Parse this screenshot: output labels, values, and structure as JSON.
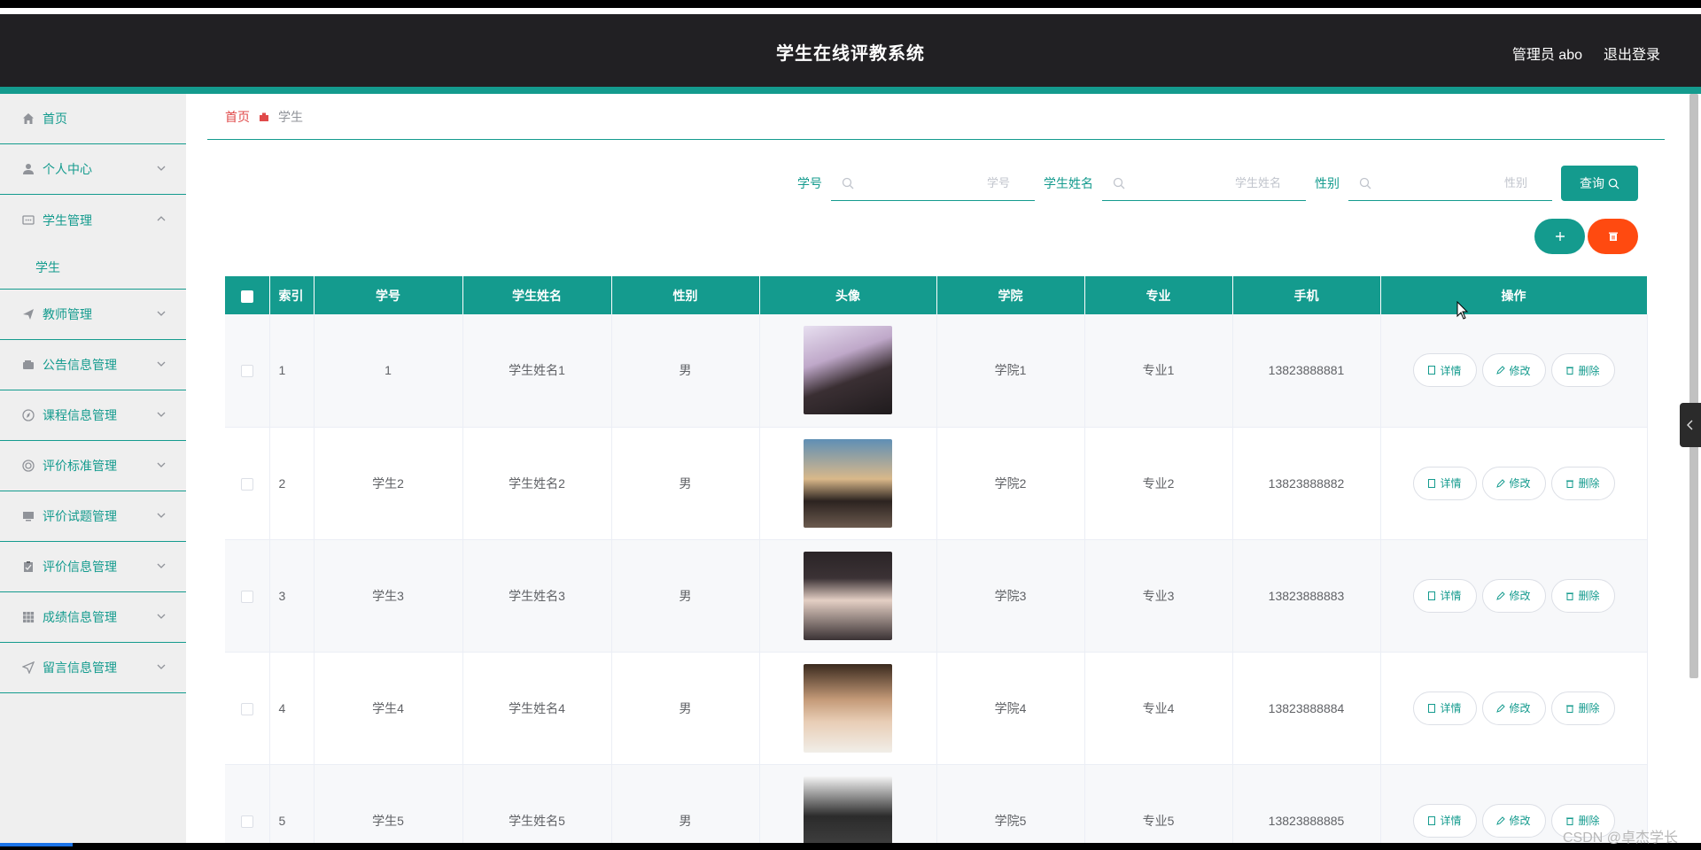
{
  "header": {
    "title": "学生在线评教系统",
    "user_label": "管理员 abo",
    "logout_label": "退出登录"
  },
  "sidebar": {
    "items": [
      {
        "label": "首页",
        "icon": "home-icon"
      },
      {
        "label": "个人中心",
        "icon": "user-icon"
      },
      {
        "label": "学生管理",
        "icon": "chat-icon"
      },
      {
        "label": "教师管理",
        "icon": "send-icon"
      },
      {
        "label": "公告信息管理",
        "icon": "wallet-icon"
      },
      {
        "label": "课程信息管理",
        "icon": "compass-icon"
      },
      {
        "label": "评价标准管理",
        "icon": "target-icon"
      },
      {
        "label": "评价试题管理",
        "icon": "monitor-icon"
      },
      {
        "label": "评价信息管理",
        "icon": "clipboard-icon"
      },
      {
        "label": "成绩信息管理",
        "icon": "grid-icon"
      },
      {
        "label": "留言信息管理",
        "icon": "paper-plane-icon"
      }
    ],
    "submenu_student": "学生"
  },
  "breadcrumb": {
    "home": "首页",
    "current": "学生"
  },
  "search": {
    "fields": [
      {
        "label": "学号",
        "placeholder": "学号"
      },
      {
        "label": "学生姓名",
        "placeholder": "学生姓名"
      },
      {
        "label": "性别",
        "placeholder": "性别"
      }
    ],
    "query_label": "查询"
  },
  "table": {
    "columns": [
      "索引",
      "学号",
      "学生姓名",
      "性别",
      "头像",
      "学院",
      "专业",
      "手机",
      "操作"
    ],
    "rows": [
      {
        "index": "1",
        "sno": "1",
        "name": "学生姓名1",
        "gender": "男",
        "college": "学院1",
        "major": "专业1",
        "phone": "13823888881"
      },
      {
        "index": "2",
        "sno": "学生2",
        "name": "学生姓名2",
        "gender": "男",
        "college": "学院2",
        "major": "专业2",
        "phone": "13823888882"
      },
      {
        "index": "3",
        "sno": "学生3",
        "name": "学生姓名3",
        "gender": "男",
        "college": "学院3",
        "major": "专业3",
        "phone": "13823888883"
      },
      {
        "index": "4",
        "sno": "学生4",
        "name": "学生姓名4",
        "gender": "男",
        "college": "学院4",
        "major": "专业4",
        "phone": "13823888884"
      },
      {
        "index": "5",
        "sno": "学生5",
        "name": "学生姓名5",
        "gender": "男",
        "college": "学院5",
        "major": "专业5",
        "phone": "13823888885"
      }
    ],
    "actions": {
      "detail": "详情",
      "edit": "修改",
      "delete": "删除"
    }
  },
  "watermark": "CSDN @卓杰学长",
  "colors": {
    "accent": "#149b8e",
    "header_bg": "#212023",
    "danger": "#ff4a10",
    "breadcrumb_home": "#e04a4a"
  }
}
